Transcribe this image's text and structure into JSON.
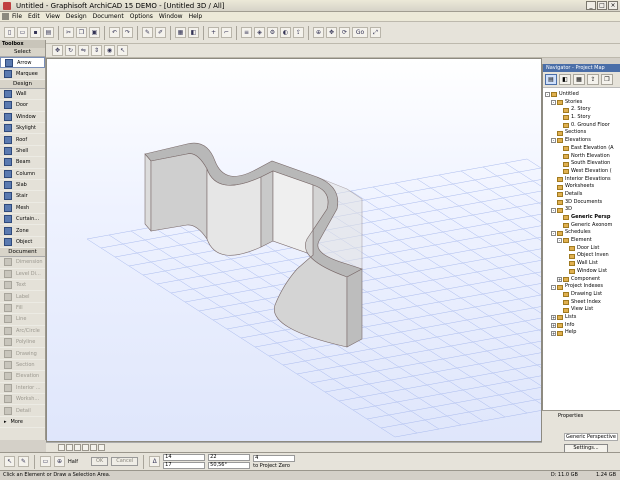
{
  "window": {
    "title": "Untitled - Graphisoft ArchiCAD 15 DEMO - [Untitled 3D / All]"
  },
  "menu": [
    "File",
    "Edit",
    "View",
    "Design",
    "Document",
    "Options",
    "Window",
    "Help"
  ],
  "toolbar": {
    "goto_label": "Go",
    "zoom_text": "Half"
  },
  "toolbox": {
    "title": "Toolbox",
    "select_head": "Select",
    "select_items": [
      {
        "label": "Arrow",
        "icon": "arrow-icon"
      },
      {
        "label": "Marquee",
        "icon": "marquee-icon"
      }
    ],
    "design_head": "Design",
    "design_items": [
      {
        "label": "Wall",
        "icon": "wall-icon"
      },
      {
        "label": "Door",
        "icon": "door-icon"
      },
      {
        "label": "Window",
        "icon": "window-icon"
      },
      {
        "label": "Skylight",
        "icon": "skylight-icon"
      },
      {
        "label": "Roof",
        "icon": "roof-icon"
      },
      {
        "label": "Shell",
        "icon": "shell-icon"
      },
      {
        "label": "Beam",
        "icon": "beam-icon"
      },
      {
        "label": "Column",
        "icon": "column-icon"
      },
      {
        "label": "Slab",
        "icon": "slab-icon"
      },
      {
        "label": "Stair",
        "icon": "stair-icon"
      },
      {
        "label": "Mesh",
        "icon": "mesh-icon"
      },
      {
        "label": "Curtain...",
        "icon": "curtain-wall-icon"
      },
      {
        "label": "Zone",
        "icon": "zone-icon"
      },
      {
        "label": "Object",
        "icon": "object-icon"
      }
    ],
    "document_head": "Document",
    "document_items": [
      {
        "label": "Dimension",
        "icon": "dimension-icon"
      },
      {
        "label": "Level Di...",
        "icon": "level-dimension-icon"
      },
      {
        "label": "Text",
        "icon": "text-icon"
      },
      {
        "label": "Label",
        "icon": "label-icon"
      },
      {
        "label": "Fill",
        "icon": "fill-icon"
      },
      {
        "label": "Line",
        "icon": "line-icon"
      },
      {
        "label": "Arc/Circle",
        "icon": "arc-icon"
      },
      {
        "label": "Polyline",
        "icon": "polyline-icon"
      },
      {
        "label": "Drawing",
        "icon": "drawing-icon"
      },
      {
        "label": "Section",
        "icon": "section-icon"
      },
      {
        "label": "Elevation",
        "icon": "elevation-icon"
      },
      {
        "label": "Interior ...",
        "icon": "interior-elevation-icon"
      },
      {
        "label": "Worksh...",
        "icon": "worksheet-icon"
      },
      {
        "label": "Detail",
        "icon": "detail-icon"
      }
    ],
    "more_label": "More"
  },
  "navigator": {
    "title": "Navigator - Project Map",
    "tree": [
      {
        "label": "Untitled",
        "indent": 0,
        "toggle": "-"
      },
      {
        "label": "Stories",
        "indent": 1,
        "toggle": "-"
      },
      {
        "label": "2. Story",
        "indent": 2,
        "toggle": ""
      },
      {
        "label": "1. Story",
        "indent": 2,
        "toggle": ""
      },
      {
        "label": "0. Ground Floor",
        "indent": 2,
        "toggle": ""
      },
      {
        "label": "Sections",
        "indent": 1,
        "toggle": ""
      },
      {
        "label": "Elevations",
        "indent": 1,
        "toggle": "-"
      },
      {
        "label": "East Elevation (A",
        "indent": 2,
        "toggle": ""
      },
      {
        "label": "North Elevation",
        "indent": 2,
        "toggle": ""
      },
      {
        "label": "South Elevation",
        "indent": 2,
        "toggle": ""
      },
      {
        "label": "West Elevation (",
        "indent": 2,
        "toggle": ""
      },
      {
        "label": "Interior Elevations",
        "indent": 1,
        "toggle": ""
      },
      {
        "label": "Worksheets",
        "indent": 1,
        "toggle": ""
      },
      {
        "label": "Details",
        "indent": 1,
        "toggle": ""
      },
      {
        "label": "3D Documents",
        "indent": 1,
        "toggle": ""
      },
      {
        "label": "3D",
        "indent": 1,
        "toggle": "-"
      },
      {
        "label": "Generic Persp",
        "indent": 2,
        "toggle": "",
        "selected": true
      },
      {
        "label": "Generic Axonom",
        "indent": 2,
        "toggle": ""
      },
      {
        "label": "Schedules",
        "indent": 1,
        "toggle": "-"
      },
      {
        "label": "Element",
        "indent": 2,
        "toggle": "-"
      },
      {
        "label": "Door List",
        "indent": 3,
        "toggle": ""
      },
      {
        "label": "Object Inven",
        "indent": 3,
        "toggle": ""
      },
      {
        "label": "Wall List",
        "indent": 3,
        "toggle": ""
      },
      {
        "label": "Window List",
        "indent": 3,
        "toggle": ""
      },
      {
        "label": "Component",
        "indent": 2,
        "toggle": "+"
      },
      {
        "label": "Project Indexes",
        "indent": 1,
        "toggle": "-"
      },
      {
        "label": "Drawing List",
        "indent": 2,
        "toggle": ""
      },
      {
        "label": "Sheet Index",
        "indent": 2,
        "toggle": ""
      },
      {
        "label": "View List",
        "indent": 2,
        "toggle": ""
      },
      {
        "label": "Lists",
        "indent": 1,
        "toggle": "+"
      },
      {
        "label": "Info",
        "indent": 1,
        "toggle": "+"
      },
      {
        "label": "Help",
        "indent": 1,
        "toggle": "+"
      }
    ]
  },
  "properties": {
    "title": "Properties",
    "view_name": "Generic Perspective",
    "settings_label": "Settings..."
  },
  "infobox": {
    "ok_label": "OK",
    "cancel_label": "Cancel",
    "dx": "14",
    "dy": "17",
    "dr": "22",
    "da": "50,56°",
    "dz": "4",
    "z_ref": "to Project Zero"
  },
  "status": {
    "message": "Click an Element or Draw a Selection Area.",
    "disk": "D: 11.0 GB",
    "memory": "1.24 GB"
  },
  "colors": {
    "accent": "#4a6ea8",
    "wall_face": "#d9d9d9",
    "wall_top": "#a8a8a8",
    "grid": "#aabbee"
  }
}
